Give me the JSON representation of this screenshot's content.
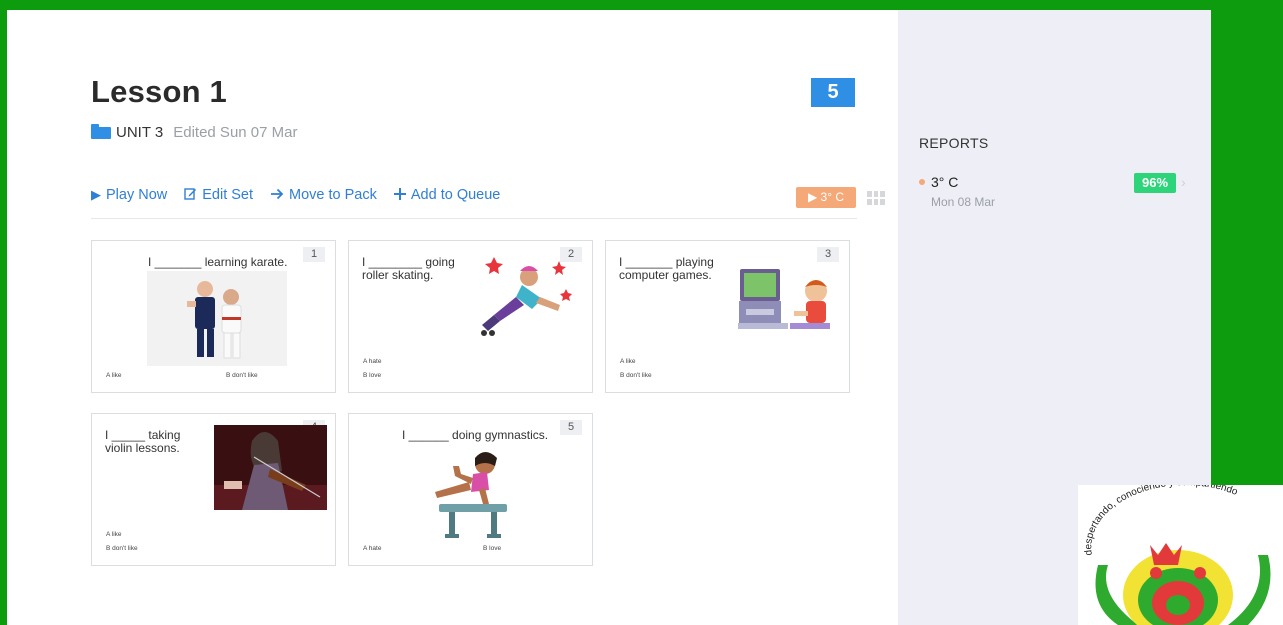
{
  "lesson": {
    "title": "Lesson 1",
    "question_count": "5",
    "folder": "UNIT 3",
    "edited": "Edited Sun 07 Mar"
  },
  "actions": [
    {
      "label": "Play Now",
      "icon": "play-icon"
    },
    {
      "label": "Edit Set",
      "icon": "edit-icon"
    },
    {
      "label": "Move to Pack",
      "icon": "arrow-right-icon"
    },
    {
      "label": "Add to Queue",
      "icon": "plus-icon"
    }
  ],
  "temp_button": "▶ 3° C",
  "cards": [
    {
      "num": "1",
      "question": "I _______ learning karate.",
      "opt_a": "A  like",
      "opt_b": "B  don't like",
      "picture": "karate-kids"
    },
    {
      "num": "2",
      "question": "I ________ going roller skating.",
      "opt_a": "A  hate",
      "opt_b": "B  love",
      "picture": "roller-skater"
    },
    {
      "num": "3",
      "question": "I _______ playing computer games.",
      "opt_a": "A  like",
      "opt_b": "B  don't like",
      "picture": "computer-gamer"
    },
    {
      "num": "4",
      "question": "I _____ taking violin lessons.",
      "opt_a": "A  like",
      "opt_b": "B  don't like",
      "picture": "violinist"
    },
    {
      "num": "5",
      "question": "I ______ doing gymnastics.",
      "opt_a": "A  hate",
      "opt_b": "B  love",
      "picture": "gymnast"
    }
  ],
  "reports": {
    "title": "REPORTS",
    "items": [
      {
        "name": "3° C",
        "date": "Mon 08 Mar",
        "score": "96%"
      }
    ]
  },
  "logo": {
    "text": "despertando, conociendo y compartiendo"
  },
  "colors": {
    "accent": "#2f8fe4",
    "background": "#0d9c0d",
    "orange": "#f5a878",
    "success": "#2ed47a"
  }
}
